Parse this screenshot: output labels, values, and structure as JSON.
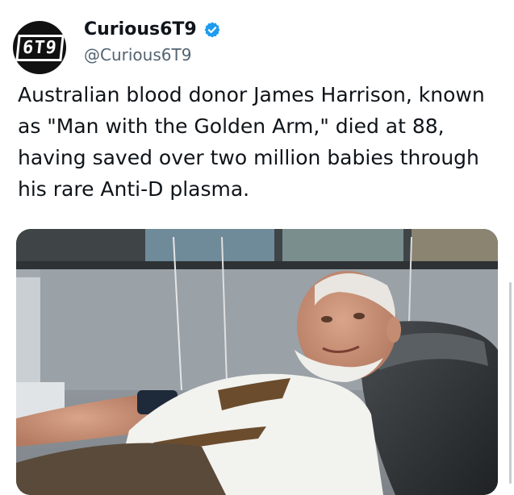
{
  "author": {
    "display_name": "Curious6T9",
    "handle": "@Curious6T9",
    "avatar_text": "6T9",
    "verified": true
  },
  "tweet": {
    "text": "Australian blood donor James Harrison, known as \"Man with the Golden Arm,\" died at 88, having saved over two million babies through his rare Anti-D plasma."
  },
  "media": {
    "type": "photo"
  },
  "colors": {
    "verified_blue": "#1d9bf0",
    "text": "#0f1419",
    "secondary_text": "#536471"
  },
  "icons": [
    "verified-badge-icon"
  ]
}
